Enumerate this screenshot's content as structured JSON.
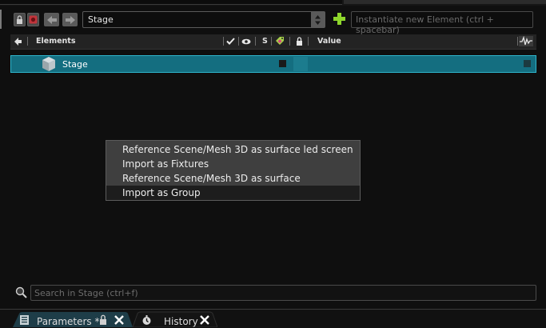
{
  "toolbar": {
    "stage_value": "Stage",
    "instantiate_placeholder": "Instantiate new Element (ctrl + spacebar)"
  },
  "header": {
    "elements": "Elements",
    "s": "S",
    "value": "Value"
  },
  "tree": {
    "rows": [
      {
        "label": "Stage",
        "icon": "cube-icon"
      }
    ]
  },
  "context_menu": {
    "items": [
      "Reference Scene/Mesh 3D as surface led screen",
      "Import as Fixtures",
      "Reference Scene/Mesh 3D as surface",
      "Import as Group"
    ],
    "highlighted_index": 3
  },
  "search": {
    "placeholder": "Search in Stage (ctrl+f)"
  },
  "tabs": [
    {
      "label": "Parameters *",
      "active": true
    },
    {
      "label": "History",
      "active": false
    }
  ],
  "colors": {
    "selection": "#146e80",
    "selection_border": "#2fb5cc",
    "plus_green": "#8ed62c"
  }
}
